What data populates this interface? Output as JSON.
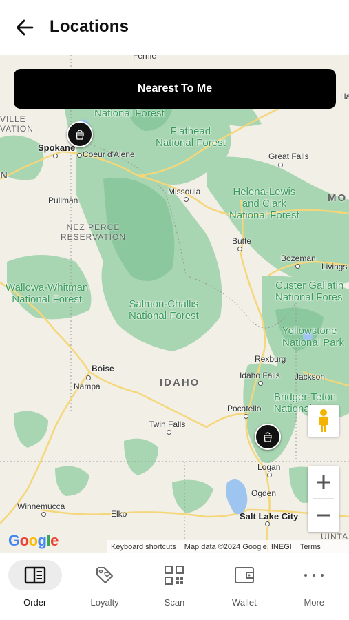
{
  "header": {
    "title": "Locations",
    "back_icon": "arrow-left-icon"
  },
  "map": {
    "nearest_button_label": "Nearest To Me",
    "forests": [
      "National Forest",
      "Flathead\nNational Forest",
      "Helena-Lewis\nand Clark\nNational Forest",
      "Wallowa-Whitman\nNational Forest",
      "Salmon-Challis\nNational Forest",
      "Custer Gallatin\nNational Fores",
      "Yellowstone\nNational Park",
      "Bridger-Teton\nNational"
    ],
    "reservation": "NEZ PERCE\nRESERVATION",
    "states": {
      "idaho": "IDAHO",
      "montana": "MO",
      "partial_n": "N",
      "ville": "VILLE\nVATION",
      "ha": "Ha"
    },
    "cities": {
      "fernie": "Fernie",
      "spokane": "Spokane",
      "coeur_dalene": "Coeur d'Alene",
      "great_falls": "Great Falls",
      "missoula": "Missoula",
      "pullman": "Pullman",
      "butte": "Butte",
      "bozeman": "Bozeman",
      "livingston": "Livings",
      "boise": "Boise",
      "nampa": "Nampa",
      "rexburg": "Rexburg",
      "idaho_falls": "Idaho Falls",
      "jackson": "Jackson",
      "pocatello": "Pocatello",
      "twin_falls": "Twin Falls",
      "logan": "Logan",
      "ogden": "Ogden",
      "winnemucca": "Winnemucca",
      "elko": "Elko",
      "salt_lake_city": "Salt Lake City",
      "uintah": "UINTA"
    },
    "google_logo": "Google",
    "attribution": {
      "shortcuts": "Keyboard shortcuts",
      "data": "Map data ©2024 Google, INEGI",
      "terms": "Terms"
    },
    "markers": [
      "store-marker-north",
      "store-marker-south"
    ],
    "colors": {
      "land": "#f1efe6",
      "forest": "#a8d5b2",
      "forest_dark": "#7fc294",
      "road": "#f5d77a",
      "water": "#9ec4f0"
    }
  },
  "bottom_nav": {
    "items": [
      {
        "label": "Order",
        "icon": "order-book-icon",
        "active": true
      },
      {
        "label": "Loyalty",
        "icon": "loyalty-tag-icon",
        "active": false
      },
      {
        "label": "Scan",
        "icon": "qr-scan-icon",
        "active": false
      },
      {
        "label": "Wallet",
        "icon": "wallet-icon",
        "active": false
      },
      {
        "label": "More",
        "icon": "more-dots-icon",
        "active": false
      }
    ]
  }
}
